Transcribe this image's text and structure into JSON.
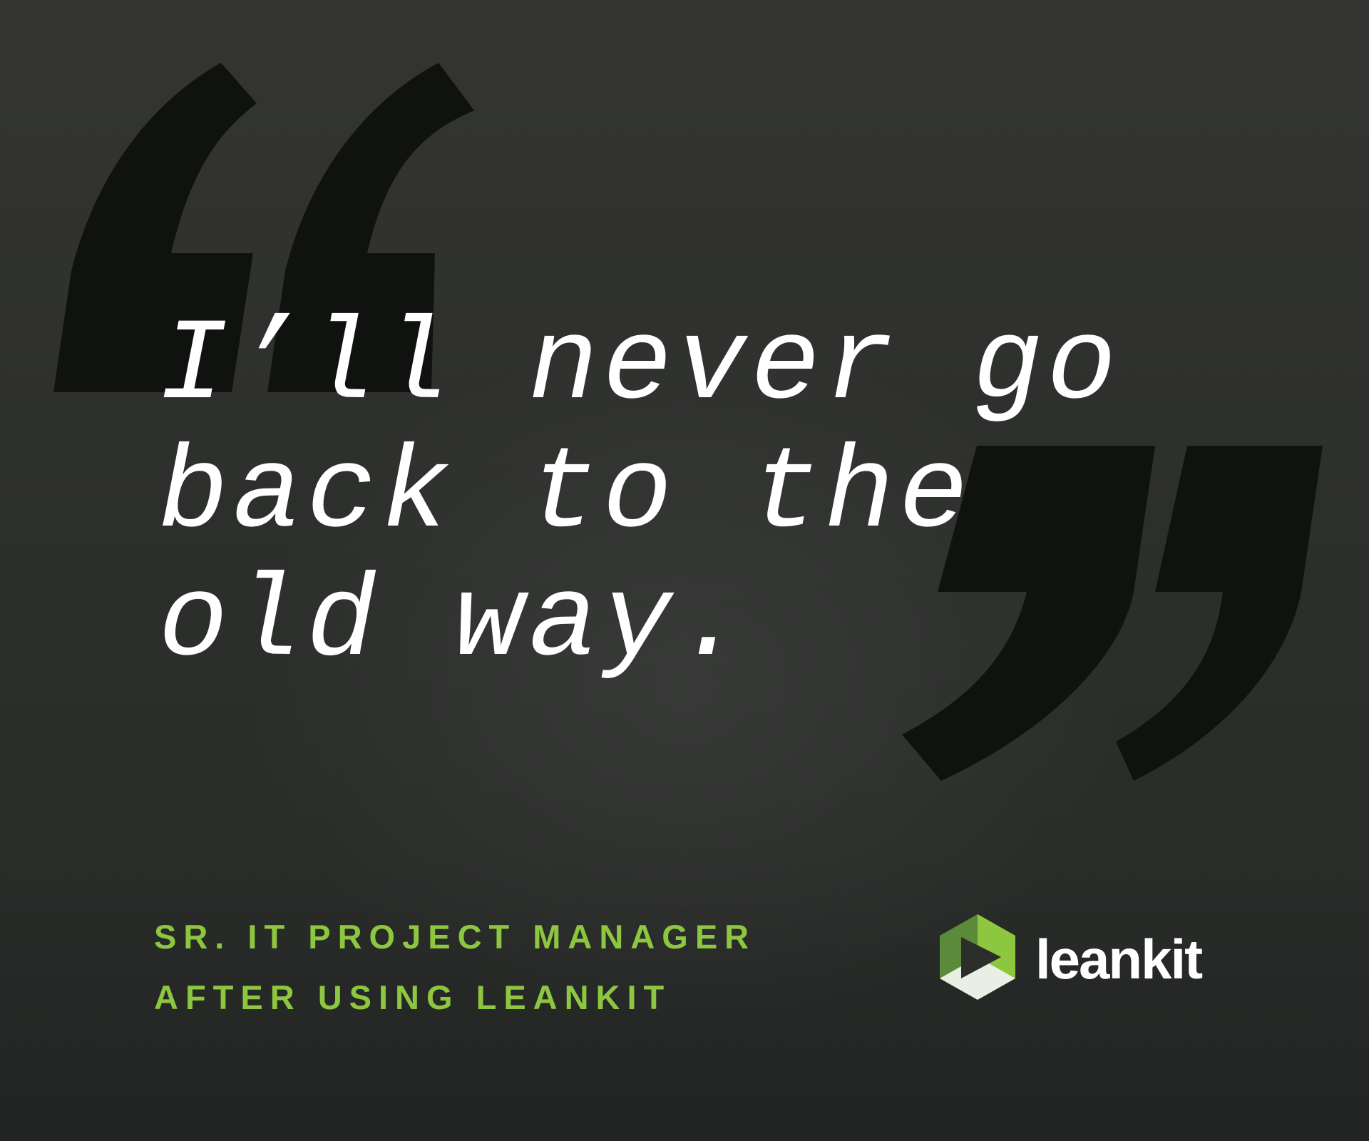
{
  "quote": {
    "lines": [
      "I’ll never go",
      "back to the",
      "old way."
    ]
  },
  "attribution": {
    "lines": [
      "SR. IT PROJECT MANAGER",
      "AFTER USING LEANKIT"
    ]
  },
  "brand": {
    "name": "leankit"
  },
  "colors": {
    "background": "#2c2e2c",
    "quote_marks": "#101210",
    "quote_text": "#ffffff",
    "accent": "#8dc63f",
    "logo_green_dark": "#5a8a3a",
    "logo_green_light": "#8dc63f"
  },
  "icons": {
    "open_quote": "open-quote-icon",
    "close_quote": "close-quote-icon",
    "logo": "leankit-logo-icon"
  }
}
